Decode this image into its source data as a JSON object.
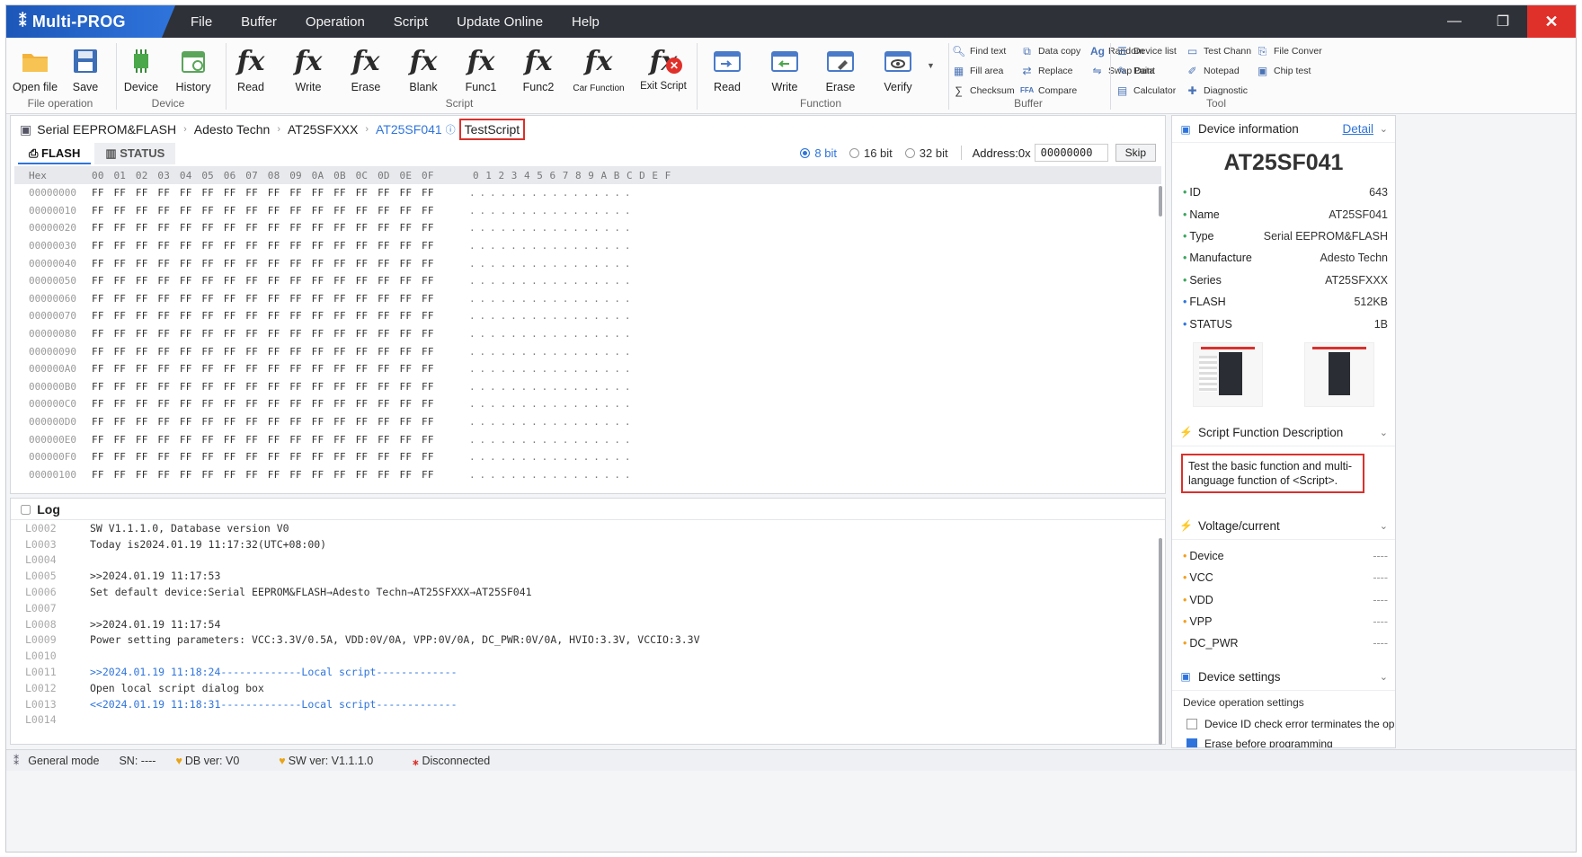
{
  "app": {
    "title": "Multi-PROG"
  },
  "menu": [
    "File",
    "Buffer",
    "Operation",
    "Script",
    "Update Online",
    "Help"
  ],
  "ribbon": {
    "file_group": "File operation",
    "open": "Open file",
    "save": "Save",
    "device_group": "Device",
    "device": "Device",
    "history": "History",
    "script_group": "Script",
    "script_btns": [
      "Read",
      "Write",
      "Erase",
      "Blank",
      "Func1",
      "Func2",
      "Car Function",
      "Exit Script"
    ],
    "function_group": "Function",
    "function_btns": [
      "Read",
      "Write",
      "Erase",
      "Verify"
    ],
    "buffer_group": "Buffer",
    "buffer_btns": [
      "Find text",
      "Fill area",
      "Checksum",
      "Data copy",
      "Replace",
      "Compare",
      "Random",
      "Swap Data"
    ],
    "tool_group": "Tool",
    "tool_btns": [
      "Device list",
      "Paint",
      "Calculator",
      "Test Chann",
      "Notepad",
      "Diagnostic",
      "File Conver",
      "Chip test"
    ]
  },
  "breadcrumb": [
    "Serial EEPROM&FLASH",
    "Adesto Techn",
    "AT25SFXXX",
    "AT25SF041",
    "TestScript"
  ],
  "tabs": [
    "FLASH",
    "STATUS"
  ],
  "bit_options": [
    "8 bit",
    "16 bit",
    "32 bit"
  ],
  "address": {
    "label": "Address:0x",
    "value": "00000000",
    "skip": "Skip"
  },
  "hex": {
    "header_addr": "Hex",
    "header_bytes": "00 01 02 03 04 05 06 07 08 09 0A 0B 0C 0D 0E 0F",
    "header_ascii": "0 1 2 3 4 5 6 7 8 9 A B C D E F",
    "rows": [
      "00000000",
      "00000010",
      "00000020",
      "00000030",
      "00000040",
      "00000050",
      "00000060",
      "00000070",
      "00000080",
      "00000090",
      "000000A0",
      "000000B0",
      "000000C0",
      "000000D0",
      "000000E0",
      "000000F0",
      "00000100"
    ],
    "byte_line": "FF FF FF FF FF FF FF FF FF FF FF FF FF FF FF FF",
    "ascii_line": "................"
  },
  "log": {
    "title": "Log",
    "lines": [
      {
        "n": "L0002",
        "t": "SW V1.1.1.0, Database version V0",
        "blue": false
      },
      {
        "n": "L0003",
        "t": "Today is2024.01.19 11:17:32(UTC+08:00)",
        "blue": false
      },
      {
        "n": "L0004",
        "t": "",
        "blue": false
      },
      {
        "n": "L0005",
        "t": ">>2024.01.19 11:17:53",
        "blue": false
      },
      {
        "n": "L0006",
        "t": "Set default device:Serial EEPROM&FLASH→Adesto Techn→AT25SFXXX→AT25SF041",
        "blue": false
      },
      {
        "n": "L0007",
        "t": "",
        "blue": false
      },
      {
        "n": "L0008",
        "t": ">>2024.01.19 11:17:54",
        "blue": false
      },
      {
        "n": "L0009",
        "t": "Power setting parameters: VCC:3.3V/0.5A, VDD:0V/0A, VPP:0V/0A, DC_PWR:0V/0A, HVIO:3.3V, VCCIO:3.3V",
        "blue": false
      },
      {
        "n": "L0010",
        "t": "",
        "blue": false
      },
      {
        "n": "L0011",
        "t": ">>2024.01.19 11:18:24-------------Local script-------------",
        "blue": true
      },
      {
        "n": "L0012",
        "t": "Open local script dialog box",
        "blue": false
      },
      {
        "n": "L0013",
        "t": "<<2024.01.19 11:18:31-------------Local script-------------",
        "blue": true
      },
      {
        "n": "L0014",
        "t": "",
        "blue": false
      }
    ]
  },
  "device_info": {
    "title": "Device information",
    "detail": "Detail",
    "name": "AT25SF041",
    "props": [
      {
        "k": "ID",
        "v": "643"
      },
      {
        "k": "Name",
        "v": "AT25SF041"
      },
      {
        "k": "Type",
        "v": "Serial EEPROM&FLASH"
      },
      {
        "k": "Manufacture",
        "v": "Adesto Techn"
      },
      {
        "k": "Series",
        "v": "AT25SFXXX"
      },
      {
        "k": "FLASH",
        "v": "512KB"
      },
      {
        "k": "STATUS",
        "v": "1B"
      }
    ]
  },
  "script_desc": {
    "title": "Script Function Description",
    "text": "Test the basic function and multi-language function of <Script>."
  },
  "voltage": {
    "title": "Voltage/current",
    "rows": [
      {
        "k": "Device",
        "v": "----"
      },
      {
        "k": "VCC",
        "v": "----"
      },
      {
        "k": "VDD",
        "v": "----"
      },
      {
        "k": "VPP",
        "v": "----"
      },
      {
        "k": "DC_PWR",
        "v": "----"
      }
    ]
  },
  "device_settings": {
    "title": "Device settings",
    "subtitle": "Device operation settings",
    "opt1": "Device ID check error terminates the op",
    "opt2": "Erase before programming"
  },
  "statusbar": {
    "mode": "General mode",
    "sn": "SN: ----",
    "db": "DB ver: V0",
    "sw": "SW ver: V1.1.1.0",
    "conn": "Disconnected"
  },
  "colors": {
    "accent": "#2f74dc",
    "highlight": "#d9312c",
    "titlebar": "#2e3138"
  }
}
